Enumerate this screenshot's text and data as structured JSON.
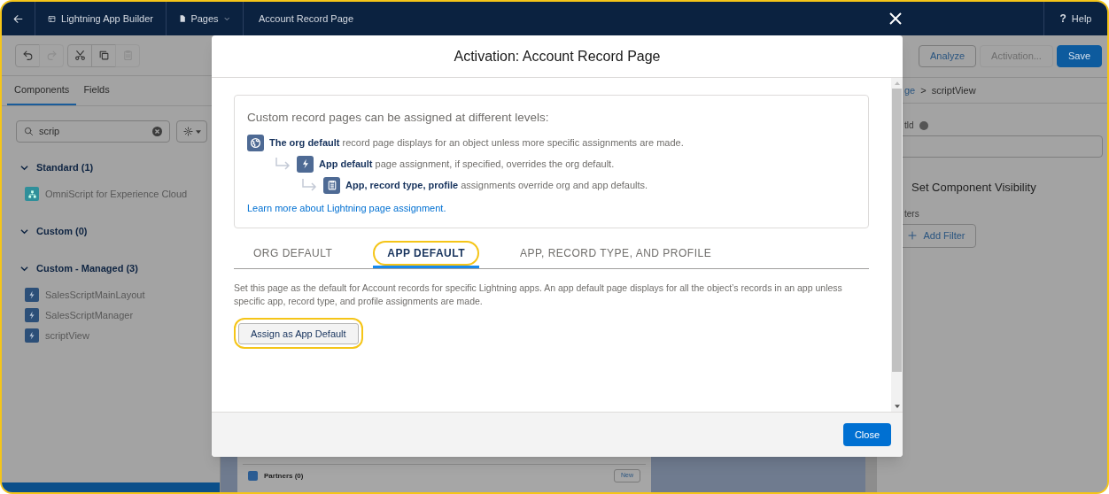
{
  "header": {
    "app_name": "Lightning App Builder",
    "pages_menu": "Pages",
    "page_title": "Account Record Page",
    "help_icon": "?",
    "help": "Help"
  },
  "toolbar": [
    {
      "kind": "undo",
      "disabled": false
    },
    {
      "kind": "redo",
      "disabled": true
    },
    {
      "kind": "cut",
      "disabled": false
    },
    {
      "kind": "copy",
      "disabled": false
    },
    {
      "kind": "paste",
      "disabled": true
    }
  ],
  "left_tabs": [
    {
      "label": "Components",
      "selected": true
    },
    {
      "label": "Fields",
      "selected": false
    }
  ],
  "search": {
    "value": "scrip"
  },
  "sections": [
    {
      "title": "Standard (1)",
      "expanded": true,
      "items": [
        {
          "label": "OmniScript for Experience Cloud",
          "kind": "standard"
        }
      ]
    },
    {
      "title": "Custom (0)",
      "expanded": true
    },
    {
      "title": "Custom - Managed (3)",
      "expanded": true,
      "items": [
        {
          "label": "SalesScriptMainLayout",
          "kind": "managed"
        },
        {
          "label": "SalesScriptManager",
          "kind": "managed"
        },
        {
          "label": "scriptView",
          "kind": "managed"
        }
      ]
    }
  ],
  "canvas": {
    "card_title": "Partners (0)",
    "card_button": "New"
  },
  "right_panel": {
    "buttons": [
      {
        "label": "Analyze",
        "kind": "neutral",
        "disabled": false
      },
      {
        "label": "Activation...",
        "kind": "neutral",
        "disabled": true
      },
      {
        "label": "Save",
        "kind": "brand"
      }
    ],
    "breadcrumb_fragment": "ge",
    "breadcrumb_separator": ">",
    "breadcrumb_current": "scriptView",
    "field_label_fragment": "tld",
    "section_title": "Set Component Visibility",
    "filters_label_fragment": "ters",
    "add_filter": "Add Filter"
  },
  "modal": {
    "title": "Activation: Account Record Page",
    "intro": "Custom record pages can be assigned at different levels:",
    "levels": [
      {
        "kind": "org",
        "text": "**The org default** record page displays for an object unless more specific assignments are made."
      },
      {
        "kind": "app",
        "text": "**App default** page assignment, if specified, overrides the org default."
      },
      {
        "kind": "profile",
        "text": "**App, record type, profile** assignments override org and app defaults."
      }
    ],
    "link": "Learn more about Lightning page assignment.",
    "tabs": [
      {
        "label": "ORG DEFAULT",
        "selected": false,
        "highlighted": false
      },
      {
        "label": "APP DEFAULT",
        "selected": true,
        "highlighted": true
      },
      {
        "label": "APP, RECORD TYPE, AND PROFILE",
        "selected": false,
        "highlighted": false
      }
    ],
    "description": "Set this page as the default for Account records for specific Lightning apps. An app default page displays for all the object’s records in an app unless specific app, record type, and profile assignments are made.",
    "assign_button": {
      "label": "Assign as App Default",
      "highlighted": true
    },
    "close_button": "Close"
  }
}
